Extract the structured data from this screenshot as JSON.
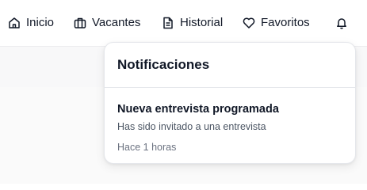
{
  "nav": {
    "items": [
      {
        "label": "Inicio",
        "icon": "home-icon"
      },
      {
        "label": "Vacantes",
        "icon": "briefcase-icon"
      },
      {
        "label": "Historial",
        "icon": "document-icon"
      },
      {
        "label": "Favoritos",
        "icon": "heart-icon"
      }
    ],
    "bell_icon": "bell-icon"
  },
  "notifications": {
    "title": "Notificaciones",
    "items": [
      {
        "title": "Nueva entrevista programada",
        "message": "Has sido invitado a una entrevista",
        "time": "Hace 1 horas"
      }
    ]
  }
}
